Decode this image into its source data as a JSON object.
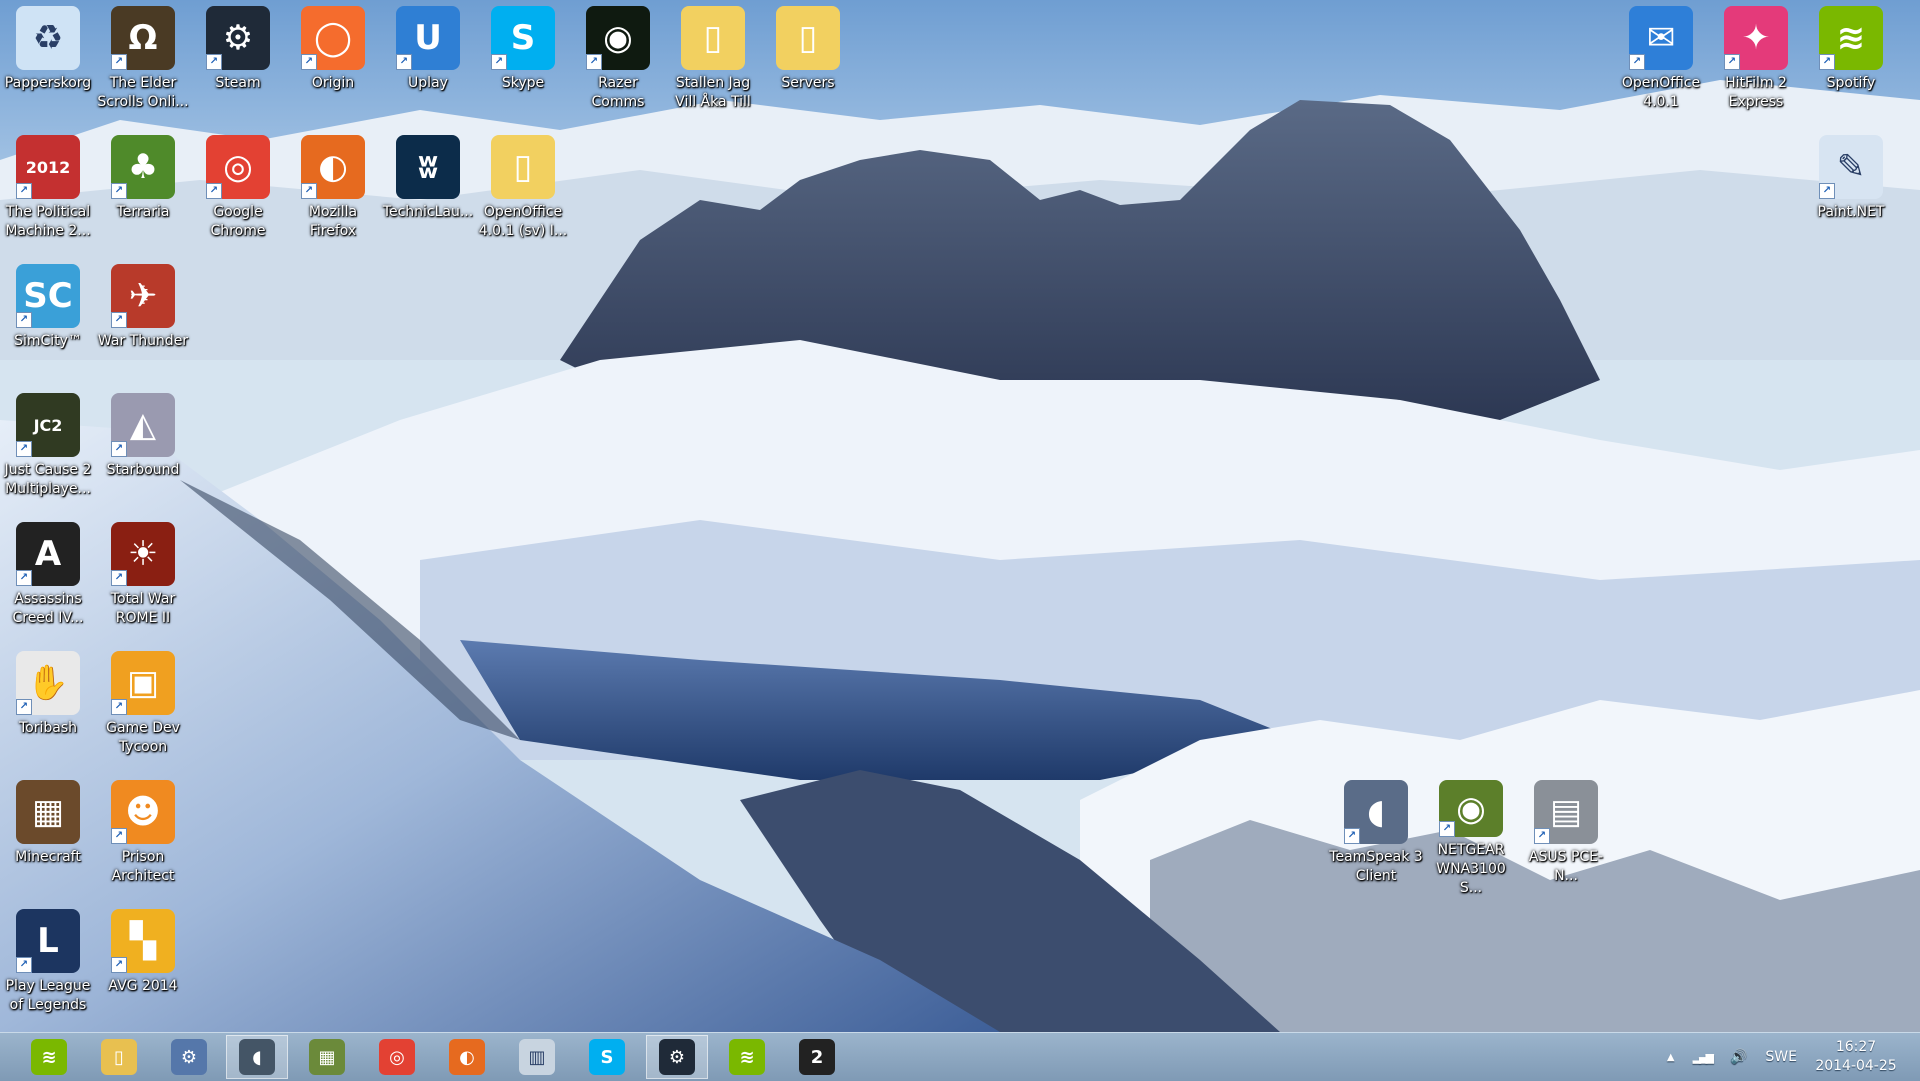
{
  "desktop_icons": [
    {
      "key": "recycle",
      "label": "Papperskorg",
      "icon": "recycle-bin-icon",
      "color": "#cfe3f5",
      "glyph": "♻",
      "shortcut": false
    },
    {
      "key": "elder",
      "label": "The Elder Scrolls Onli...",
      "icon": "elder-scrolls-icon",
      "color": "#4a3a24",
      "glyph": "Ω",
      "shortcut": true
    },
    {
      "key": "steam",
      "label": "Steam",
      "icon": "steam-icon",
      "color": "#1f2a38",
      "glyph": "⚙",
      "shortcut": true
    },
    {
      "key": "origin",
      "label": "Origin",
      "icon": "origin-icon",
      "color": "#f56c2d",
      "glyph": "◯",
      "shortcut": true
    },
    {
      "key": "uplay",
      "label": "Uplay",
      "icon": "uplay-icon",
      "color": "#2f7fd4",
      "glyph": "U",
      "shortcut": true
    },
    {
      "key": "skype",
      "label": "Skype",
      "icon": "skype-icon",
      "color": "#00aff0",
      "glyph": "S",
      "shortcut": true
    },
    {
      "key": "razer",
      "label": "Razer Comms",
      "icon": "razer-comms-icon",
      "color": "#0f1a10",
      "glyph": "◉",
      "shortcut": true
    },
    {
      "key": "stallen",
      "label": "Stallen Jag Vill Åka Till",
      "icon": "folder-icon",
      "color": "#f2d060",
      "glyph": "▯",
      "shortcut": false
    },
    {
      "key": "servers",
      "label": "Servers",
      "icon": "folder-icon",
      "color": "#f2d060",
      "glyph": "▯",
      "shortcut": false
    },
    {
      "key": "political",
      "label": "The Political Machine 2...",
      "icon": "political-machine-icon",
      "color": "#c43030",
      "glyph": "2012",
      "shortcut": true
    },
    {
      "key": "terraria",
      "label": "Terraria",
      "icon": "terraria-tree-icon",
      "color": "#4f8a2a",
      "glyph": "♣",
      "shortcut": true
    },
    {
      "key": "chrome",
      "label": "Google Chrome",
      "icon": "chrome-icon",
      "color": "#e34133",
      "glyph": "◎",
      "shortcut": true
    },
    {
      "key": "firefox",
      "label": "Mozilla Firefox",
      "icon": "firefox-icon",
      "color": "#e66a1f",
      "glyph": "◐",
      "shortcut": true
    },
    {
      "key": "technic",
      "label": "TechnicLau...",
      "icon": "technic-launcher-icon",
      "color": "#0c2c4a",
      "glyph": "ʬ",
      "shortcut": false
    },
    {
      "key": "openoffice_folder",
      "label": "OpenOffice 4.0.1 (sv) I...",
      "icon": "folder-icon",
      "color": "#f2d060",
      "glyph": "▯",
      "shortcut": false
    },
    {
      "key": "simcity",
      "label": "SimCity™",
      "icon": "simcity-icon",
      "color": "#3aa0d8",
      "glyph": "SC",
      "shortcut": true
    },
    {
      "key": "warthunder",
      "label": "War Thunder",
      "icon": "war-thunder-icon",
      "color": "#b83a2a",
      "glyph": "✈",
      "shortcut": true
    },
    {
      "key": "justcause",
      "label": "Just Cause 2 Multiplaye...",
      "icon": "just-cause-icon",
      "color": "#303a22",
      "glyph": "JC2",
      "shortcut": true
    },
    {
      "key": "starbound",
      "label": "Starbound",
      "icon": "starbound-penguin-icon",
      "color": "#9a9ab0",
      "glyph": "◭",
      "shortcut": true
    },
    {
      "key": "assassins",
      "label": "Assassins Creed IV...",
      "icon": "assassins-creed-icon",
      "color": "#222",
      "glyph": "A",
      "shortcut": true
    },
    {
      "key": "rome",
      "label": "Total War ROME II",
      "icon": "total-war-rome-icon",
      "color": "#8a1f12",
      "glyph": "☀",
      "shortcut": true
    },
    {
      "key": "toribash",
      "label": "Toribash",
      "icon": "toribash-icon",
      "color": "#e9e9e9",
      "glyph": "✋",
      "shortcut": true
    },
    {
      "key": "gamedev",
      "label": "Game Dev Tycoon",
      "icon": "game-dev-tycoon-icon",
      "color": "#f0a020",
      "glyph": "▣",
      "shortcut": true
    },
    {
      "key": "minecraft",
      "label": "Minecraft",
      "icon": "minecraft-grass-block-icon",
      "color": "#6b4a2b",
      "glyph": "▦",
      "shortcut": false
    },
    {
      "key": "prison",
      "label": "Prison Architect",
      "icon": "prison-architect-icon",
      "color": "#f08a20",
      "glyph": "☻",
      "shortcut": true
    },
    {
      "key": "league",
      "label": "Play League of Legends",
      "icon": "league-of-legends-icon",
      "color": "#1c3560",
      "glyph": "L",
      "shortcut": true
    },
    {
      "key": "avg",
      "label": "AVG 2014",
      "icon": "avg-antivirus-icon",
      "color": "#f0b020",
      "glyph": "▚",
      "shortcut": true
    },
    {
      "key": "openoffice",
      "label": "OpenOffice 4.0.1",
      "icon": "openoffice-gull-icon",
      "color": "#2e7fd8",
      "glyph": "✉",
      "shortcut": true
    },
    {
      "key": "hitfilm",
      "label": "HitFilm 2 Express",
      "icon": "hitfilm-icon",
      "color": "#e43a7a",
      "glyph": "✦",
      "shortcut": true
    },
    {
      "key": "spotify",
      "label": "Spotify",
      "icon": "spotify-icon",
      "color": "#7ab800",
      "glyph": "≋",
      "shortcut": true
    },
    {
      "key": "paintnet",
      "label": "Paint.NET",
      "icon": "paint-net-icon",
      "color": "#d7e4f2",
      "glyph": "✎",
      "shortcut": true
    },
    {
      "key": "teamspeak",
      "label": "TeamSpeak 3 Client",
      "icon": "teamspeak-icon",
      "color": "#5a6c88",
      "glyph": "◖",
      "shortcut": true
    },
    {
      "key": "netgear",
      "label": "NETGEAR WNA3100 S...",
      "icon": "netgear-wifi-icon",
      "color": "#5c7f2a",
      "glyph": "◉",
      "shortcut": true
    },
    {
      "key": "asus",
      "label": "ASUS PCE-N...",
      "icon": "asus-network-card-icon",
      "color": "#8a9098",
      "glyph": "▤",
      "shortcut": true
    }
  ],
  "taskbar": {
    "buttons": [
      {
        "key": "spotify",
        "icon": "spotify-icon",
        "color": "#7ab800",
        "glyph": "≋",
        "active": false
      },
      {
        "key": "explorer",
        "icon": "file-explorer-icon",
        "color": "#e8c050",
        "glyph": "▯",
        "active": false
      },
      {
        "key": "settings",
        "icon": "settings-gear-icon",
        "color": "#5577aa",
        "glyph": "⚙",
        "active": false
      },
      {
        "key": "teamspeak",
        "icon": "teamspeak-icon",
        "color": "#445566",
        "glyph": "◖",
        "active": true
      },
      {
        "key": "minecraft",
        "icon": "minecraft-grass-block-icon",
        "color": "#6b8a3a",
        "glyph": "▦",
        "active": false
      },
      {
        "key": "chrome",
        "icon": "chrome-icon",
        "color": "#e34133",
        "glyph": "◎",
        "active": false
      },
      {
        "key": "firefox",
        "icon": "firefox-icon",
        "color": "#e66a1f",
        "glyph": "◐",
        "active": false
      },
      {
        "key": "taskmgr",
        "icon": "task-manager-icon",
        "color": "#c8d4e0",
        "glyph": "▥",
        "active": false
      },
      {
        "key": "skype",
        "icon": "skype-icon",
        "color": "#00aff0",
        "glyph": "S",
        "active": false
      },
      {
        "key": "steam",
        "icon": "steam-icon",
        "color": "#1f2a38",
        "glyph": "⚙",
        "active": true
      },
      {
        "key": "spotify2",
        "icon": "spotify-icon",
        "color": "#7ab800",
        "glyph": "≋",
        "active": false
      },
      {
        "key": "app2",
        "icon": "circled-two-app-icon",
        "color": "#222",
        "glyph": "2",
        "active": false
      }
    ],
    "tray": {
      "chevron": "▲",
      "network": "▂▄▆",
      "volume": "🔊",
      "language": "SWE",
      "time": "16:27",
      "date": "2014-04-25"
    }
  }
}
